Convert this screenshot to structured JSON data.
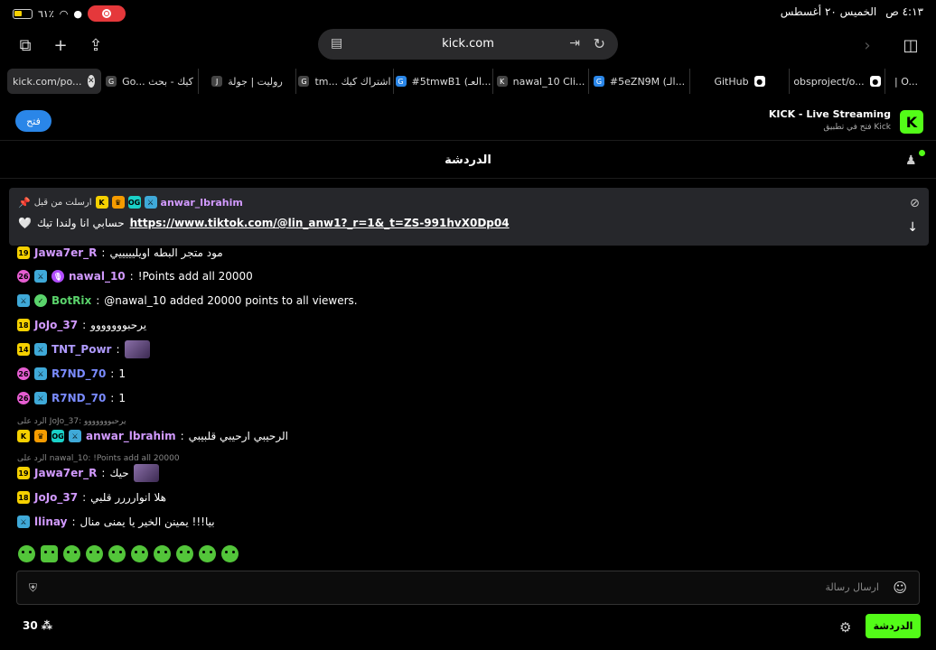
{
  "status": {
    "battery": "٦١٪",
    "time": "٤:١٣ ص",
    "date": "الخميس ٢٠ أغسطس"
  },
  "browser": {
    "url": "kick.com",
    "tabs": [
      {
        "label": "kick.com/po...",
        "icon": "x",
        "active": true
      },
      {
        "label": "Go... كيك - بحث",
        "icon": "G"
      },
      {
        "label": "روليت | جولة",
        "icon": "J"
      },
      {
        "label": "tm... اشتراك كيك",
        "icon": "G"
      },
      {
        "label": "#5tmwB1 (العـ...",
        "icon": "G"
      },
      {
        "label": "nawal_10 Cli...",
        "icon": "K"
      },
      {
        "label": "#5eZN9M (الـ...",
        "icon": "G"
      },
      {
        "label": "GitHub",
        "icon": "github"
      },
      {
        "label": "obsproject/o...",
        "icon": "github"
      },
      {
        "label": "| O...",
        "icon": "o"
      }
    ]
  },
  "banner": {
    "open_label": "فتح",
    "app_title": "KICK - Live Streaming",
    "app_subtitle": "فتح في تطبيق Kick",
    "accent": "#53fc18"
  },
  "chat": {
    "title": "الدردشة",
    "pinned": {
      "user": "anwar_lbrahim",
      "ago": "ارسلت من قبل",
      "link": "https://www.tiktok.com/@lin_anw1?_r=1&_t=ZS-991hvX0Dp04",
      "text": "حسابي انا ولندا تيك"
    },
    "messages": [
      {
        "user": "Jawa7er_R",
        "color": "#d29aff",
        "text": "مود متجر البطه اويليييييي"
      },
      {
        "user": "nawal_10",
        "color": "#d29aff",
        "text": "!Points add all 20000"
      },
      {
        "user": "BotRix",
        "color": "#5ad36b",
        "text": "@nawal_10 added 20000 points to all viewers."
      },
      {
        "user": "JoJo_37",
        "color": "#d29aff",
        "text": "يرحبووووووو"
      },
      {
        "user": "TNT_Powr",
        "color": "#b09bff",
        "text": ""
      },
      {
        "user": "R7ND_70",
        "color": "#7a8bff",
        "text": "1"
      },
      {
        "user": "R7ND_70",
        "color": "#7a8bff",
        "text": "1"
      },
      {
        "user": "anwar_lbrahim",
        "color": "#d29aff",
        "text": "الرحيبي ارحيبي قلبيبي",
        "reply": "الرد على JoJo_37: يرحبووووووو"
      },
      {
        "user": "Jawa7er_R",
        "color": "#d29aff",
        "text": "حيك",
        "reply": "الرد على nawal_10: !Points add all 20000"
      },
      {
        "user": "JoJo_37",
        "color": "#d29aff",
        "text": "هلا انوارررر قلبي"
      },
      {
        "user": "llinay",
        "color": "#d29aff",
        "text": "بيا!!! يمينن الخير يا يمنى منال"
      }
    ],
    "input_placeholder": "ارسال رسالة",
    "points": "30",
    "send_label": "الدردشة"
  }
}
